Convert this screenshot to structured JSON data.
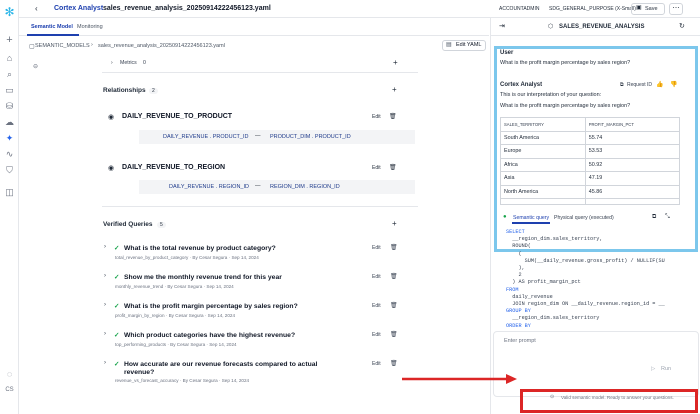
{
  "topbar": {
    "title": "Cortex Analyst",
    "file": "sales_revenue_analysis_20250914222456123.yaml",
    "account": "ACCOUNTADMIN",
    "warehouse": "SDG_GENERAL_PURPOSE (X-Small)",
    "save_label": "Save"
  },
  "tabs": [
    "Semantic Model",
    "Monitoring"
  ],
  "breadcrumb": {
    "root": "SEMANTIC_MODELS",
    "file": "sales_revenue_analysis_20250914222456123.yaml",
    "edit_label": "Edit YAML"
  },
  "metrics": {
    "label": "Metrics",
    "count": "0"
  },
  "relationships": {
    "title": "Relationships",
    "count": "2",
    "items": [
      {
        "name": "DAILY_REVENUE_TO_PRODUCT",
        "left": "DAILY_REVENUE . PRODUCT_ID",
        "right": "PRODUCT_DIM . PRODUCT_ID"
      },
      {
        "name": "DAILY_REVENUE_TO_REGION",
        "left": "DAILY_REVENUE . REGION_ID",
        "right": "REGION_DIM . REGION_ID"
      }
    ],
    "edit_label": "Edit"
  },
  "verified": {
    "title": "Verified Queries",
    "count": "5",
    "items": [
      {
        "q": "What is the total revenue by product category?",
        "meta": "total_revenue_by_product_category  ·  By Cesar Segura  ·  Sep 14, 2024"
      },
      {
        "q": "Show me the monthly revenue trend for this year",
        "meta": "monthly_revenue_trend  ·  By Cesar Segura  ·  Sep 14, 2024"
      },
      {
        "q": "What is the profit margin percentage by sales region?",
        "meta": "profit_margin_by_region  ·  By Cesar Segura  ·  Sep 14, 2024"
      },
      {
        "q": "Which product categories have the highest revenue?",
        "meta": "top_performing_products  ·  By Cesar Segura  ·  Sep 14, 2024"
      },
      {
        "q": "How accurate are our revenue forecasts compared to actual",
        "q2": "revenue?",
        "meta": "revenue_vs_forecast_accuracy  ·  By Cesar Segura  ·  Sep 14, 2024"
      }
    ]
  },
  "panel": {
    "title": "SALES_REVENUE_ANALYSIS",
    "user_label": "User",
    "user_msg": "What is the profit margin percentage by sales region?",
    "analyst_label": "Cortex Analyst",
    "request_id": "Request ID",
    "interp_intro": "This is our interpretation of your question:",
    "interp_q": "What is the profit margin percentage by sales region?",
    "columns": [
      "SALES_TERRITORY",
      "PROFIT_MARGIN_PCT"
    ],
    "rows": [
      [
        "South America",
        "55.74"
      ],
      [
        "Europe",
        "53.53"
      ],
      [
        "Africa",
        "50.92"
      ],
      [
        "Asia",
        "47.19"
      ],
      [
        "North America",
        "45.86"
      ]
    ],
    "semantic_tab": "Semantic query",
    "physical_tab": "Physical query (executed)",
    "code": [
      "SELECT",
      "  __region_dim.sales_territory,",
      "  ROUND(",
      "    (",
      "      SUM(__daily_revenue.gross_profit) / NULLIF(SU",
      "    ),",
      "    2",
      "  ) AS profit_margin_pct",
      "FROM",
      "  daily_revenue",
      "  JOIN region_dim ON __daily_revenue.region_id = __",
      "GROUP BY",
      "  __region_dim.sales_territory",
      "ORDER BY"
    ],
    "prompt_placeholder": "Enter prompt",
    "run_label": "Run",
    "status": "Valid semantic model. Ready to answer your questions."
  },
  "rail": {
    "avatar": "CS"
  }
}
